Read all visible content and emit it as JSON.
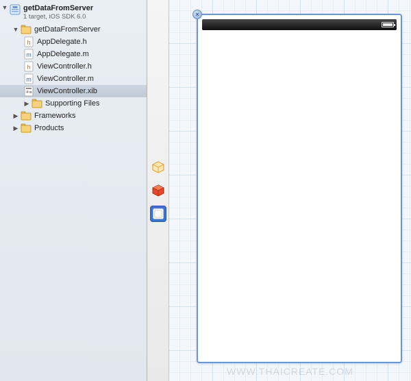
{
  "project": {
    "name": "getDataFromServer",
    "subtitle": "1 target, iOS SDK 6.0"
  },
  "tree": {
    "group_name": "getDataFromServer",
    "files": {
      "appdelegate_h": "AppDelegate.h",
      "appdelegate_m": "AppDelegate.m",
      "viewcontroller_h": "ViewController.h",
      "viewcontroller_m": "ViewController.m",
      "viewcontroller_xib": "ViewController.xib"
    },
    "supporting": "Supporting Files",
    "frameworks": "Frameworks",
    "products": "Products"
  },
  "dock": {
    "placeholder_icon": "placeholder-cube",
    "first_responder_icon": "first-responder-cube",
    "view_icon": "view-icon"
  },
  "canvas": {
    "device": "iphone-view"
  },
  "watermark": "WWW.THAICREATE.COM"
}
